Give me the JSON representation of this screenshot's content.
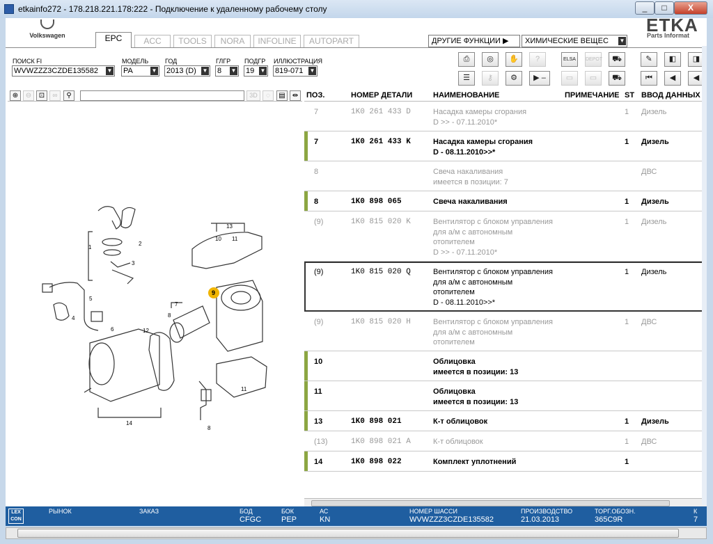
{
  "window": {
    "title": "etkainfo272 - 178.218.221.178:222 - Подключение к удаленному рабочему столу",
    "controls": [
      "_",
      "□",
      "X"
    ]
  },
  "brand": {
    "vw": "Volkswagen",
    "etka": "ETKA",
    "etka_sub": "Parts Informat"
  },
  "tabs": [
    "EPC",
    "ACC",
    "TOOLS",
    "NORA",
    "INFOLINE",
    "AUTOPART"
  ],
  "active_tab": "EPC",
  "menus": {
    "other": "ДРУГИЕ ФУНКЦИИ ▶",
    "chem": "ХИМИЧЕСКИЕ ВЕЩЕС"
  },
  "fields": {
    "fi": {
      "label": "ПОИСК FI",
      "value": "WVWZZZ3CZDE135582"
    },
    "model": {
      "label": "МОДЕЛЬ",
      "value": "PA"
    },
    "year": {
      "label": "ГОД",
      "value": "2013 (D)"
    },
    "main_group": {
      "label": "ГЛГР",
      "value": "8"
    },
    "sub_group": {
      "label": "ПОДГР",
      "value": "19"
    },
    "illustration": {
      "label": "ИЛЛЮСТРАЦИЯ",
      "value": "819-071"
    }
  },
  "toolbar": {
    "row1": [
      "print-icon",
      "parts-icon",
      "hands-icon",
      "help-icon",
      "elsa-icon",
      "depot-icon",
      "cart-add-icon"
    ],
    "row2": [
      "list-icon",
      "key-icon",
      "bike-icon",
      "play-minus-icon",
      "elsa2-icon",
      "depot2-icon",
      "cart-icon"
    ],
    "labels": {
      "elsa": "ELSA",
      "depot": "DEPOT",
      "play": "▶ –"
    },
    "right1": [
      "pin-icon",
      "book-back-icon",
      "book-icon"
    ],
    "right2": [
      "first-icon",
      "prev-icon",
      "back-icon"
    ]
  },
  "zoom": {
    "labels": [
      "3D"
    ]
  },
  "columns": [
    "ПОЗ.",
    "НОМЕР ДЕТАЛИ",
    "НАИМЕНОВАНИЕ",
    "ПРИМЕЧАНИЕ",
    "ST",
    "ВВОД ДАННЫХ"
  ],
  "rows": [
    {
      "pos": "7",
      "part": "1K0  261  433  D",
      "name": "Насадка камеры сгорания\nD             >> - 07.11.2010*",
      "st": "1",
      "note": "Дизель",
      "state": "inactive"
    },
    {
      "pos": "7",
      "part": "1K0  261  433  K",
      "name": "Насадка камеры сгорания\nD - 08.11.2010>>*",
      "st": "1",
      "note": "Дизель",
      "state": "active"
    },
    {
      "pos": "8",
      "part": "",
      "name": "Свеча накаливания\n                           имеется в позиции:  7",
      "st": "",
      "note": "ДВС",
      "state": "inactive"
    },
    {
      "pos": "8",
      "part": "1K0  898  065",
      "name": "Свеча накаливания",
      "st": "1",
      "note": "Дизель",
      "state": "active"
    },
    {
      "pos": "(9)",
      "part": "1K0  815  020  K",
      "name": "Вентилятор с блоком управления\nдля а/м с автономным\nотопителем\nD             >> - 07.11.2010*",
      "st": "1",
      "note": "Дизель",
      "state": "inactive"
    },
    {
      "pos": "(9)",
      "part": "1K0  815  020  Q",
      "name": "Вентилятор с блоком управления\nдля а/м с автономным\nотопителем\nD - 08.11.2010>>*",
      "st": "1",
      "note": "Дизель",
      "state": "selected"
    },
    {
      "pos": "(9)",
      "part": "1K0  815  020  H",
      "name": "Вентилятор с блоком управления\nдля а/м с автономным\nотопителем",
      "st": "1",
      "note": "ДВС",
      "state": "inactive"
    },
    {
      "pos": "10",
      "part": "",
      "name": "Облицовка\n                           имеется в позиции:  13",
      "st": "",
      "note": "",
      "state": "active"
    },
    {
      "pos": "11",
      "part": "",
      "name": "Облицовка\n                           имеется в позиции:  13",
      "st": "",
      "note": "",
      "state": "active"
    },
    {
      "pos": "13",
      "part": "1K0  898  021",
      "name": "К-т облицовок",
      "st": "1",
      "note": "Дизель",
      "state": "active"
    },
    {
      "pos": "(13)",
      "part": "1K0  898  021  A",
      "name": "К-т облицовок",
      "st": "1",
      "note": "ДВС",
      "state": "inactive"
    },
    {
      "pos": "14",
      "part": "1K0  898  022",
      "name": "Комплект уплотнений",
      "st": "1",
      "note": "",
      "state": "active"
    }
  ],
  "callouts": [
    "1",
    "2",
    "3",
    "4",
    "5",
    "6",
    "7",
    "8",
    "9",
    "10",
    "11",
    "12",
    "13",
    "14"
  ],
  "status": {
    "logo": "LEX\nCON",
    "market": "РЫНОК",
    "order": "ЗАКАЗ",
    "bod": {
      "label": "БОД",
      "value": "CFGC"
    },
    "bok": {
      "label": "БОК",
      "value": "PEP"
    },
    "ac": {
      "label": "АС",
      "value": "KN"
    },
    "vin": {
      "label": "НОМЕР ШАССИ",
      "value": "WVWZZZ3CZDE135582"
    },
    "prod": {
      "label": "ПРОИЗВОДСТВО",
      "value": "21.03.2013"
    },
    "torg": {
      "label": "ТОРГ.ОБОЗН.",
      "value": "365C9R"
    },
    "k": {
      "label": "К",
      "value": "7"
    }
  },
  "colors": {
    "status_bg": "#1f5ea0",
    "active_bar": "#8ca642",
    "callout_badge": "#f0b400"
  }
}
